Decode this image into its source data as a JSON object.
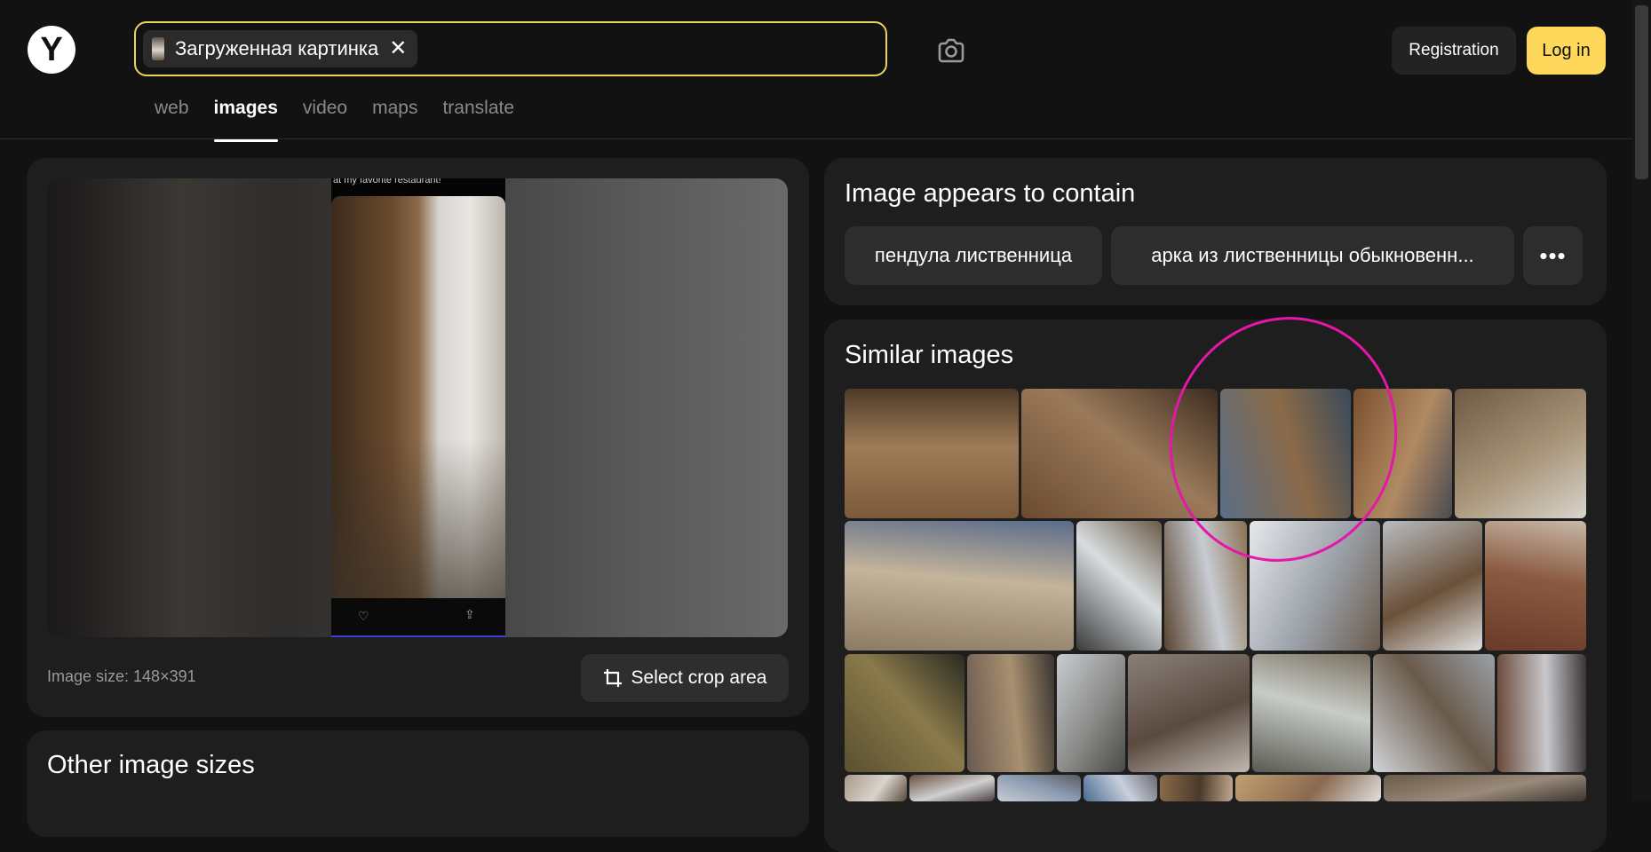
{
  "header": {
    "logo": "Y",
    "search_chip_label": "Загруженная картинка",
    "search_chip_close": "✕",
    "registration_label": "Registration",
    "login_label": "Log in",
    "accent_color": "#fed85b"
  },
  "tabs": [
    {
      "label": "web",
      "active": false
    },
    {
      "label": "images",
      "active": true
    },
    {
      "label": "video",
      "active": false
    },
    {
      "label": "maps",
      "active": false
    },
    {
      "label": "translate",
      "active": false
    }
  ],
  "preview": {
    "caption": "at my favorite restaurant!",
    "image_size_label": "Image size: 148×391",
    "crop_button_label": "Select crop area"
  },
  "other_sizes": {
    "title": "Other image sizes"
  },
  "contains": {
    "title": "Image appears to contain",
    "tags": [
      "пендула лиственница",
      "арка из лиственницы обыкновенн..."
    ],
    "more_label": "•••"
  },
  "similar": {
    "title": "Similar images",
    "annotation_color": "#e516a8",
    "thumb_colors": [
      [
        "#7a5a3a",
        "#a07c58",
        "#4c3a28"
      ],
      [
        "#6b4a30",
        "#9b7a5a",
        "#3c2c20"
      ],
      [
        "#5a6f88",
        "#8a6a48",
        "#3a4a5a"
      ],
      [
        "#7a5030",
        "#b08a62",
        "#4a4a52"
      ],
      [
        "#6e5a44",
        "#a89478",
        "#d8d4cc"
      ],
      [
        "#8c7a62",
        "#c4b49a",
        "#5a6c8a"
      ],
      [
        "#3a3a3a",
        "#d8dde0",
        "#6a5a48"
      ],
      [
        "#5a4430",
        "#c8ccd2",
        "#8a7050"
      ],
      [
        "#e6e8ec",
        "#9aa0a8",
        "#6a5a4a"
      ],
      [
        "#b8bcc0",
        "#6a5038",
        "#e0e0e0"
      ],
      [
        "#6a3a2a",
        "#8a5a40",
        "#c8b8a8"
      ],
      [
        "#5a5030",
        "#8a7a4a",
        "#2a2a22"
      ],
      [
        "#6a5a50",
        "#a89070",
        "#3a3530"
      ],
      [
        "#c8ccd0",
        "#8a8a88",
        "#4a4a48"
      ],
      [
        "#8a8078",
        "#5a4a40",
        "#c0b8b0"
      ],
      [
        "#5a5a52",
        "#c8ccc8",
        "#7a7060"
      ],
      [
        "#d0d4d8",
        "#6a5a4a",
        "#9aa0a8"
      ],
      [
        "#6a4a3a",
        "#c8c8cc",
        "#3a3434"
      ],
      [
        "#a89a88",
        "#d8d4cc",
        "#5a4a3a"
      ],
      [
        "#6a5040",
        "#d0d0d0",
        "#4a4040"
      ],
      [
        "#c8ccd4",
        "#8a9ab0",
        "#5a5a60"
      ],
      [
        "#4a6a90",
        "#c8d0dc",
        "#6a6a70"
      ],
      [
        "#8a6a48",
        "#4a3a2a",
        "#c0a890"
      ],
      [
        "#c0a070",
        "#8a6a50",
        "#e0e0e0"
      ],
      [
        "#6a5a4a",
        "#9a8a7a",
        "#3a3430"
      ]
    ]
  }
}
